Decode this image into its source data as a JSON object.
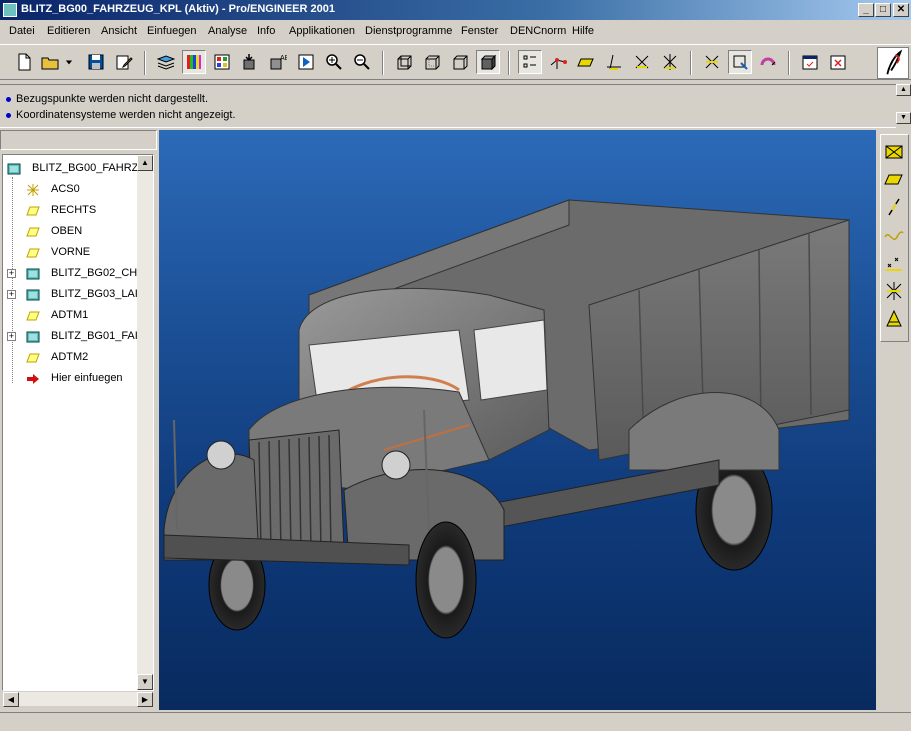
{
  "window": {
    "title": "BLITZ_BG00_FAHRZEUG_KPL (Aktiv) - Pro/ENGINEER 2001",
    "minimize": "_",
    "maximize": "□",
    "close": "✕"
  },
  "menu": [
    {
      "label": "Datei"
    },
    {
      "label": "Editieren"
    },
    {
      "label": "Ansicht"
    },
    {
      "label": "Einfuegen"
    },
    {
      "label": "Analyse"
    },
    {
      "label": "Info"
    },
    {
      "label": "Applikationen"
    },
    {
      "label": "Dienstprogramme"
    },
    {
      "label": "Fenster"
    },
    {
      "label": "DENCnorm"
    },
    {
      "label": "Hilfe"
    }
  ],
  "toolbar": {
    "icons": [
      "new-file-icon",
      "open-folder-icon",
      "dropdown-arrow-icon",
      "save-icon",
      "edit-pencil-icon",
      "layers-icon",
      "color-shade-icon",
      "appearance-grid-icon",
      "model-setup-icon",
      "regen-icon",
      "play-icon",
      "zoom-in-icon",
      "zoom-out-icon",
      "wireframe-icon",
      "hidden-line-icon",
      "no-hidden-icon",
      "shaded-icon",
      "datum-points-icon",
      "datum-axes-icon",
      "datum-planes-icon",
      "spin-center-icon",
      "coord-sys-icon",
      "model-tree-icon",
      "select-icon",
      "repaint-icon",
      "window-activate-icon",
      "close-window-icon"
    ]
  },
  "messages": [
    "Bezugspunkte werden nicht dargestellt.",
    "Koordinatensysteme werden nicht angezeigt."
  ],
  "model_tree": {
    "root": "BLITZ_BG00_FAHRZ",
    "items": [
      {
        "label": "ACS0",
        "icon": "csys-icon",
        "expandable": false
      },
      {
        "label": "RECHTS",
        "icon": "datum-plane-icon",
        "expandable": false
      },
      {
        "label": "OBEN",
        "icon": "datum-plane-icon",
        "expandable": false
      },
      {
        "label": "VORNE",
        "icon": "datum-plane-icon",
        "expandable": false
      },
      {
        "label": "BLITZ_BG02_CH",
        "icon": "subassembly-icon",
        "expandable": true
      },
      {
        "label": "BLITZ_BG03_LAI",
        "icon": "subassembly-icon",
        "expandable": true
      },
      {
        "label": "ADTM1",
        "icon": "datum-plane-icon",
        "expandable": false
      },
      {
        "label": "BLITZ_BG01_FAI",
        "icon": "subassembly-icon",
        "expandable": true
      },
      {
        "label": "ADTM2",
        "icon": "datum-plane-icon",
        "expandable": false
      },
      {
        "label": "Hier einfuegen",
        "icon": "insert-here-arrow-icon",
        "expandable": false
      }
    ],
    "expander_symbol": "+"
  },
  "right_toolbar": {
    "icons": [
      "datum-plane-tool-icon",
      "plane-icon",
      "axis-icon",
      "curve-icon",
      "point-icon",
      "csys-tool-icon",
      "analysis-icon"
    ]
  },
  "colors": {
    "titlebar_start": "#0a246a",
    "titlebar_end": "#a6caf0",
    "viewport_top": "#2c6ab8",
    "viewport_bottom": "#082a5e",
    "model_grey": "#6e6e6e",
    "datum_yellow": "#e8d800"
  }
}
